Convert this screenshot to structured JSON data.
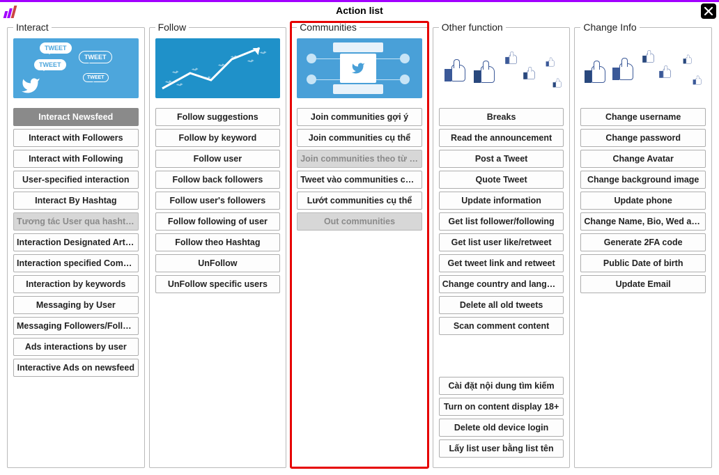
{
  "window": {
    "title": "Action list"
  },
  "panels": {
    "interact": {
      "title": "Interact",
      "highlighted": false,
      "buttons": [
        {
          "label": "Interact Newsfeed",
          "state": "selected"
        },
        {
          "label": "Interact with Followers",
          "state": "normal"
        },
        {
          "label": "Interact with Following",
          "state": "normal"
        },
        {
          "label": "User-specified interaction",
          "state": "normal"
        },
        {
          "label": "Interact By Hashtag",
          "state": "normal"
        },
        {
          "label": "Tương tác User qua hashtag",
          "state": "disabled"
        },
        {
          "label": "Interaction Designated Articles",
          "state": "normal"
        },
        {
          "label": "Interaction specified Comment",
          "state": "normal"
        },
        {
          "label": "Interaction by keywords",
          "state": "normal"
        },
        {
          "label": "Messaging by User",
          "state": "normal"
        },
        {
          "label": "Messaging Followers/Followi...",
          "state": "normal"
        },
        {
          "label": "Ads interactions by user",
          "state": "normal"
        },
        {
          "label": "Interactive Ads on newsfeed",
          "state": "normal"
        }
      ]
    },
    "follow": {
      "title": "Follow",
      "highlighted": false,
      "buttons": [
        {
          "label": "Follow suggestions",
          "state": "normal"
        },
        {
          "label": "Follow by keyword",
          "state": "normal"
        },
        {
          "label": "Follow user",
          "state": "normal"
        },
        {
          "label": "Follow back followers",
          "state": "normal"
        },
        {
          "label": "Follow user's followers",
          "state": "normal"
        },
        {
          "label": "Follow following of user",
          "state": "normal"
        },
        {
          "label": "Follow theo Hashtag",
          "state": "normal"
        },
        {
          "label": "UnFollow",
          "state": "normal"
        },
        {
          "label": "UnFollow specific users",
          "state": "normal"
        }
      ]
    },
    "communities": {
      "title": "Communities",
      "highlighted": true,
      "buttons": [
        {
          "label": "Join communities gợi ý",
          "state": "normal"
        },
        {
          "label": "Join communities cụ thể",
          "state": "normal"
        },
        {
          "label": "Join communities theo từ khóa",
          "state": "disabled"
        },
        {
          "label": "Tweet vào communities cụ thể",
          "state": "normal"
        },
        {
          "label": "Lướt communities cụ thể",
          "state": "normal"
        },
        {
          "label": "Out communities",
          "state": "disabled"
        }
      ]
    },
    "other": {
      "title": "Other function",
      "highlighted": false,
      "buttons_group1": [
        {
          "label": "Breaks",
          "state": "normal"
        },
        {
          "label": "Read the announcement",
          "state": "normal"
        },
        {
          "label": "Post a Tweet",
          "state": "normal"
        },
        {
          "label": "Quote  Tweet",
          "state": "normal"
        },
        {
          "label": "Update information",
          "state": "normal"
        },
        {
          "label": "Get list follower/following",
          "state": "normal"
        },
        {
          "label": "Get list user like/retweet",
          "state": "normal"
        },
        {
          "label": "Get tweet link and retweet",
          "state": "normal"
        },
        {
          "label": "Change country and language",
          "state": "normal"
        },
        {
          "label": "Delete all old tweets",
          "state": "normal"
        },
        {
          "label": "Scan comment content",
          "state": "normal"
        }
      ],
      "buttons_group2": [
        {
          "label": "Cài đặt nội dung tìm kiếm",
          "state": "normal"
        },
        {
          "label": "Turn on content display 18+",
          "state": "normal"
        },
        {
          "label": "Delete old device login",
          "state": "normal"
        },
        {
          "label": "Lấy list user bằng list tên",
          "state": "normal"
        }
      ]
    },
    "changeinfo": {
      "title": "Change Info",
      "highlighted": false,
      "buttons": [
        {
          "label": "Change username",
          "state": "normal"
        },
        {
          "label": "Change password",
          "state": "normal"
        },
        {
          "label": "Change Avatar",
          "state": "normal"
        },
        {
          "label": "Change background image",
          "state": "normal"
        },
        {
          "label": "Update phone",
          "state": "normal"
        },
        {
          "label": "Change Name, Bio, Wed and ...",
          "state": "normal"
        },
        {
          "label": "Generate 2FA code",
          "state": "normal"
        },
        {
          "label": "Public Date of birth",
          "state": "normal"
        },
        {
          "label": "Update Email",
          "state": "normal"
        }
      ]
    }
  }
}
